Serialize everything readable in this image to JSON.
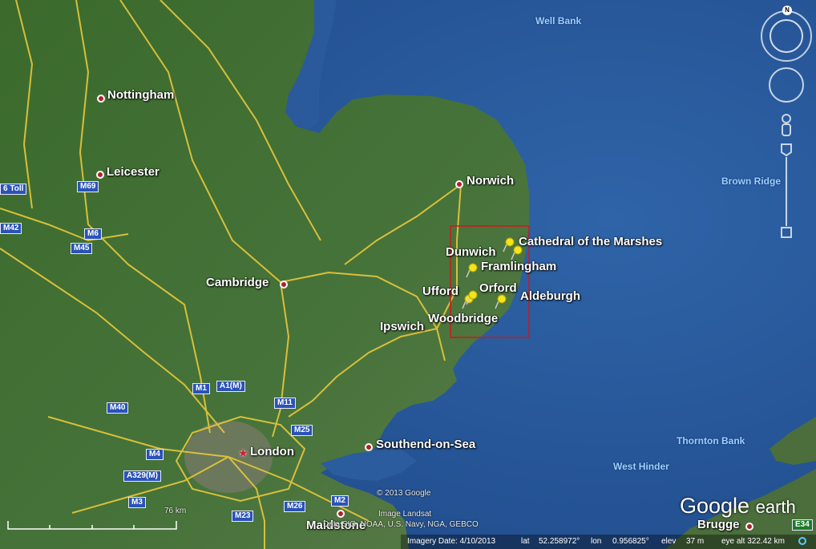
{
  "sea": {
    "labels": [
      "Well Bank",
      "Brown Ridge",
      "Thornton Bank",
      "West Hinder"
    ]
  },
  "places": {
    "nottingham": "Nottingham",
    "leicester": "Leicester",
    "norwich": "Norwich",
    "cambridge": "Cambridge",
    "ipswich": "Ipswich",
    "london": "London",
    "southend": "Southend-on-Sea",
    "maidstone": "Maidstone",
    "brugge": "Brugge"
  },
  "placemarks": [
    "Cathedral of the Marshes",
    "Dunwich",
    "Framlingham",
    "Ufford",
    "Orford",
    "Aldeburgh",
    "Woodbridge"
  ],
  "roads": {
    "m1": "M1",
    "a1m": "A1(M)",
    "m11": "M11",
    "m25": "M25",
    "m40": "M40",
    "m4": "M4",
    "a329m": "A329(M)",
    "m3": "M3",
    "m23": "M23",
    "m26": "M26",
    "m2": "M2",
    "m6": "M6",
    "m45": "M45",
    "m69": "M69",
    "m42": "M42",
    "m6toll": "6 Toll",
    "e34": "E34"
  },
  "attribution": {
    "copyright": "© 2013 Google",
    "landsat": "Image Landsat",
    "data": "Data SIO, NOAA, U.S. Navy, NGA, GEBCO"
  },
  "scale": {
    "label": "76 km"
  },
  "status": {
    "imagery_date": "Imagery Date: 4/10/2013",
    "lat_label": "lat",
    "lat": "52.258972°",
    "lon_label": "lon",
    "lon": "0.956825°",
    "elev_label": "elev",
    "elev": "37 m",
    "eye_alt": "eye alt 322.42 km"
  },
  "logo": {
    "google": "Google",
    "earth": "earth"
  },
  "compass": {
    "north": "N"
  },
  "colors": {
    "sea": "#2a5a9c",
    "land": "#3f6b2e",
    "road": "#e8c83a",
    "selection": "#d01818",
    "pin": "#f2e51c"
  }
}
